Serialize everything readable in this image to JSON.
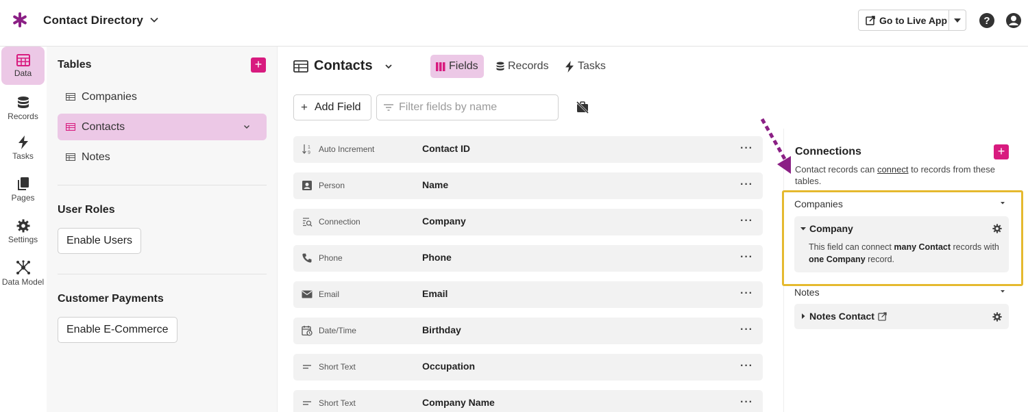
{
  "app": {
    "title": "Contact Directory",
    "logo_icon": "asterisk-logo-icon",
    "brand_color": "#8b2085",
    "accent_color": "#d81b7f",
    "highlight_color": "#e5b92e"
  },
  "topbar": {
    "live_app_label": "Go to Live App"
  },
  "nav": [
    {
      "label": "Data",
      "icon": "table-icon",
      "active": true
    },
    {
      "label": "Records",
      "icon": "database-icon"
    },
    {
      "label": "Tasks",
      "icon": "bolt-icon"
    },
    {
      "label": "Pages",
      "icon": "pages-icon"
    },
    {
      "label": "Settings",
      "icon": "gear-icon"
    },
    {
      "label": "Data Model",
      "icon": "data-model-icon"
    }
  ],
  "tables_panel": {
    "title": "Tables",
    "add_label": "+",
    "items": [
      {
        "label": "Companies"
      },
      {
        "label": "Contacts",
        "active": true
      },
      {
        "label": "Notes"
      }
    ],
    "user_roles": {
      "title": "User Roles",
      "button": "Enable Users"
    },
    "payments": {
      "title": "Customer Payments",
      "button": "Enable E-Commerce"
    }
  },
  "main": {
    "title": "Contacts",
    "tabs": [
      {
        "label": "Fields",
        "active": true
      },
      {
        "label": "Records"
      },
      {
        "label": "Tasks"
      }
    ],
    "add_field_label": "Add Field",
    "filter_placeholder": "Filter fields by name",
    "more_label": "···",
    "fields": [
      {
        "type": "Auto Increment",
        "name": "Contact ID",
        "icon": "sort-numeric-icon"
      },
      {
        "type": "Person",
        "name": "Name",
        "icon": "person-card-icon"
      },
      {
        "type": "Connection",
        "name": "Company",
        "icon": "connection-search-icon"
      },
      {
        "type": "Phone",
        "name": "Phone",
        "icon": "phone-icon"
      },
      {
        "type": "Email",
        "name": "Email",
        "icon": "envelope-icon"
      },
      {
        "type": "Date/Time",
        "name": "Birthday",
        "icon": "calendar-clock-icon"
      },
      {
        "type": "Short Text",
        "name": "Occupation",
        "icon": "short-text-icon"
      },
      {
        "type": "Short Text",
        "name": "Company Name",
        "icon": "short-text-icon"
      }
    ]
  },
  "connections": {
    "title": "Connections",
    "add_label": "+",
    "desc_before": "Contact records can ",
    "desc_link": "connect",
    "desc_after": " to records from these tables.",
    "groups": [
      {
        "label": "Companies",
        "card": {
          "name": "Company",
          "body_1": "This field can connect ",
          "body_bold_1": "many Contact",
          "body_2": " records with ",
          "body_bold_2": "one Company",
          "body_3": " record."
        }
      },
      {
        "label": "Notes",
        "card": {
          "name": "Notes Contact"
        }
      }
    ]
  }
}
